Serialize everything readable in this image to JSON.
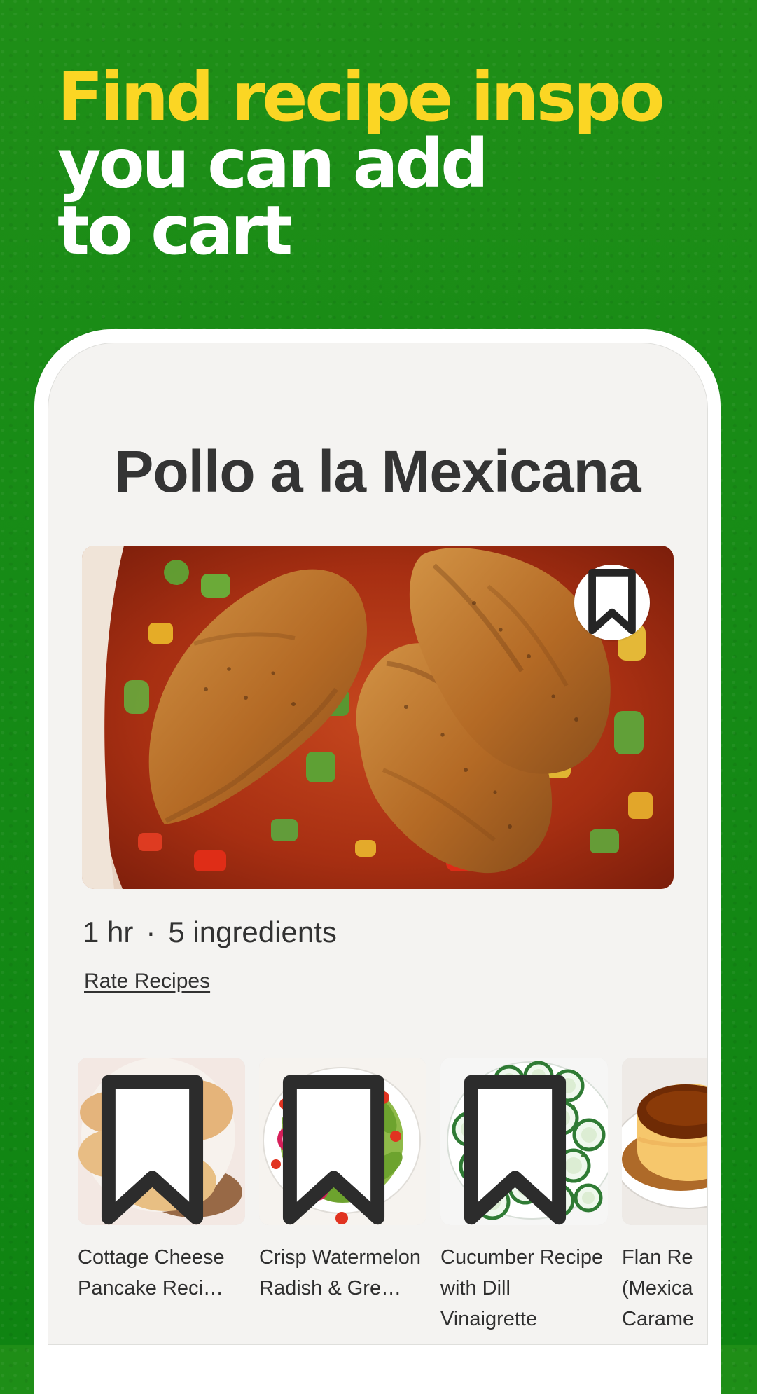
{
  "promo": {
    "headline_line1": "Find recipe inspo",
    "headline_line2": "you can add",
    "headline_line3": "to cart",
    "colors": {
      "background": "#1f8e17",
      "highlight": "#fbd624",
      "headline_secondary": "#ffffff"
    }
  },
  "recipe": {
    "title": "Pollo a la Mexicana",
    "time": "1 hr",
    "separator": "·",
    "ingredients": "5 ingredients",
    "rate_label": "Rate Recipes",
    "bookmark_icon": "bookmark-icon"
  },
  "related_recipes": [
    {
      "title": "Cottage Cheese Pancake Reci…",
      "icon": "bookmark-icon"
    },
    {
      "title": "Crisp Watermelon Radish & Gre…",
      "icon": "bookmark-icon"
    },
    {
      "title": "Cucumber Recipe with Dill Vinaigrette",
      "icon": "bookmark-icon"
    },
    {
      "title": "Flan Re (Mexica Carame",
      "icon": "bookmark-icon"
    }
  ]
}
